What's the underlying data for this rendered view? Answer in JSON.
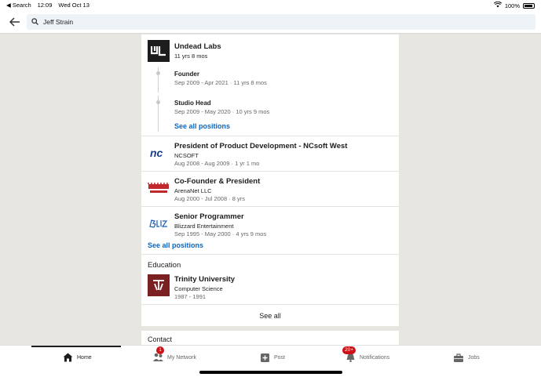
{
  "status_bar": {
    "back_app": "◀ Search",
    "time": "12:09",
    "date": "Wed Oct 13",
    "battery": "100%"
  },
  "search": {
    "query": "Jeff Strain"
  },
  "experience": {
    "undead": {
      "company": "Undead Labs",
      "duration": "11 yrs 8 mos",
      "positions": [
        {
          "title": "Founder",
          "dates": "Sep 2009 - Apr 2021 · 11 yrs 8 mos"
        },
        {
          "title": "Studio Head",
          "dates": "Sep 2009 - May 2020 · 10 yrs 9 mos"
        }
      ],
      "see_all": "See all positions"
    },
    "ncsoft": {
      "title": "President of Product Development - NCsoft West",
      "company": "NCSOFT",
      "dates": "Aug 2008 - Aug 2009 · 1 yr 1 mo"
    },
    "arenanet": {
      "title": "Co-Founder & President",
      "company": "ArenaNet LLC",
      "dates": "Aug 2000 - Jul 2008 · 8 yrs"
    },
    "blizzard": {
      "title": "Senior Programmer",
      "company": "Blizzard Entertainment",
      "dates": "Sep 1995 - May 2000 · 4 yrs 9 mos"
    },
    "see_all_positions": "See all positions"
  },
  "education": {
    "heading": "Education",
    "school": "Trinity University",
    "field": "Computer Science",
    "years": "1987 - 1991"
  },
  "see_all": "See all",
  "contact": {
    "heading": "Contact"
  },
  "tabs": [
    {
      "label": "Home",
      "icon": "home-icon"
    },
    {
      "label": "My Network",
      "icon": "network-icon",
      "badge": "1"
    },
    {
      "label": "Post",
      "icon": "post-icon"
    },
    {
      "label": "Notifications",
      "icon": "bell-icon",
      "badge": "20+"
    },
    {
      "label": "Jobs",
      "icon": "briefcase-icon"
    }
  ],
  "colors": {
    "accent": "#0a66c2",
    "badge": "#cc1016",
    "page_bg": "#e8e6e1"
  }
}
